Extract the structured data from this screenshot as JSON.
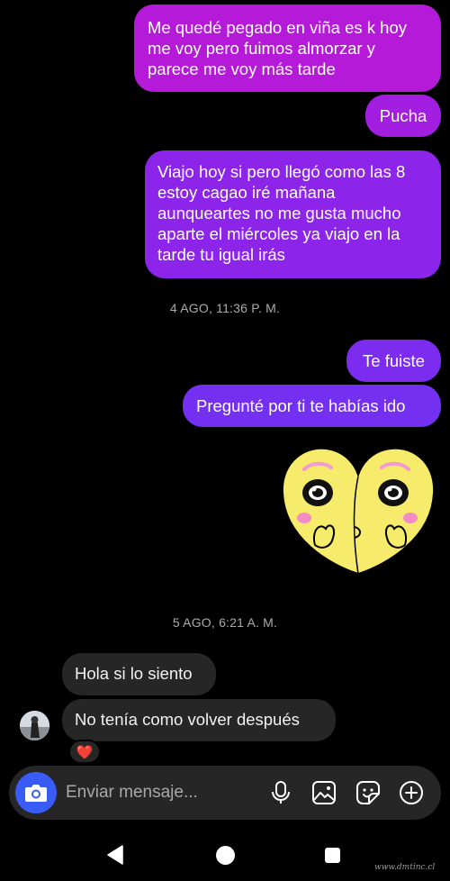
{
  "sent_messages": [
    {
      "text": "Me quedé pegado en viña es k hoy\nme voy pero fuimos almorzar y\nparece me voy más tarde"
    },
    {
      "text": "Pucha"
    },
    {
      "text": "Viajo hoy si pero llegó como las 8\nestoy cagao iré mañana\naunqueartes no me gusta mucho\naparte el miércoles ya viajo en la\ntarde tu igual irás"
    },
    {
      "text": "Te fuiste"
    },
    {
      "text": "Pregunté por ti te habías ido"
    }
  ],
  "timestamps": [
    "4 AGO, 11:36 P. M.",
    "5 AGO, 6:21 A. M."
  ],
  "received_messages": [
    {
      "text": "Hola si lo siento"
    },
    {
      "text": "No tenía como volver después"
    }
  ],
  "reaction": {
    "emoji": "❤️"
  },
  "composer": {
    "placeholder": "Enviar mensaje..."
  },
  "icons": {
    "camera": "camera-icon",
    "mic": "microphone-icon",
    "gallery": "image-icon",
    "sticker": "sticker-icon",
    "add": "plus-circle-icon"
  },
  "colors": {
    "background": "#000000",
    "sent_top": "#b61ad9",
    "sent_bottom": "#7430f0",
    "received": "#262626",
    "camera_button": "#3a5cf6",
    "heart": "#ff2d46"
  },
  "watermark": "www.dmtinc.cl"
}
